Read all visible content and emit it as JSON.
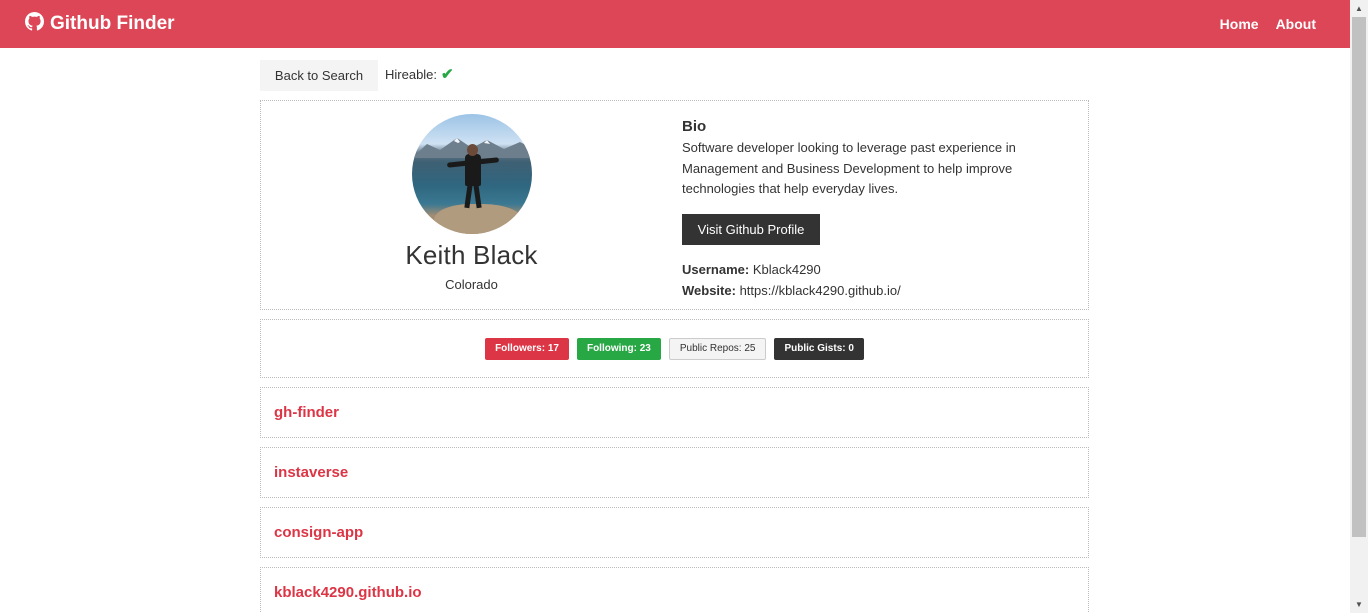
{
  "navbar": {
    "brand": "Github Finder",
    "links": [
      "Home",
      "About"
    ]
  },
  "top": {
    "back_label": "Back to Search",
    "hireable_label": "Hireable:"
  },
  "profile": {
    "name": "Keith Black",
    "location": "Colorado",
    "bio_title": "Bio",
    "bio": "Software developer looking to leverage past experience in Management and Business Development to help improve technologies that help everyday lives.",
    "visit_label": "Visit Github Profile",
    "username_label": "Username:",
    "username": "Kblack4290",
    "website_label": "Website:",
    "website": "https://kblack4290.github.io/"
  },
  "stats": {
    "followers": "Followers: 17",
    "following": "Following: 23",
    "repos": "Public Repos: 25",
    "gists": "Public Gists: 0"
  },
  "repos": [
    "gh-finder",
    "instaverse",
    "consign-app",
    "kblack4290.github.io"
  ],
  "colors": {
    "navbar": "#dc4656",
    "primary": "#dc3545",
    "success": "#28a745",
    "dark": "#333333"
  }
}
